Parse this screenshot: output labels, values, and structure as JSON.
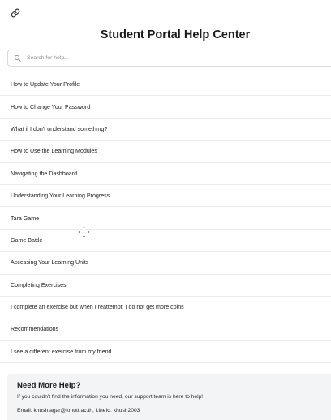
{
  "header": {
    "title": "Student Portal Help Center",
    "link_icon": "link-icon"
  },
  "search": {
    "placeholder": "Search for help...",
    "value": "",
    "icon": "search-icon"
  },
  "faq_items": [
    "How to Update Your Profile",
    "How to Change Your Password",
    "What if I don't understand something?",
    "How to Use the Learning Modules",
    "Navigating the Dashboard",
    "Understanding Your Learning Progress",
    "Tara Game",
    "Game Battle",
    "Accessing Your Learning Units",
    "Completing Exercises",
    "I complete an exercise but when I reattempt, I do not get more coins",
    "Recommendations",
    "I see a different exercise from my friend"
  ],
  "help": {
    "title": "Need More Help?",
    "text": "If you couldn't find the information you need, our support team is here to help!",
    "contact": "Email: khush.agar@kmutt.ac.th, LineId: khush2003"
  },
  "cursor": {
    "icon": "move-cursor-icon"
  },
  "colors": {
    "divider": "#ececec",
    "help_bg": "#f3f4f6",
    "text": "#202020"
  }
}
